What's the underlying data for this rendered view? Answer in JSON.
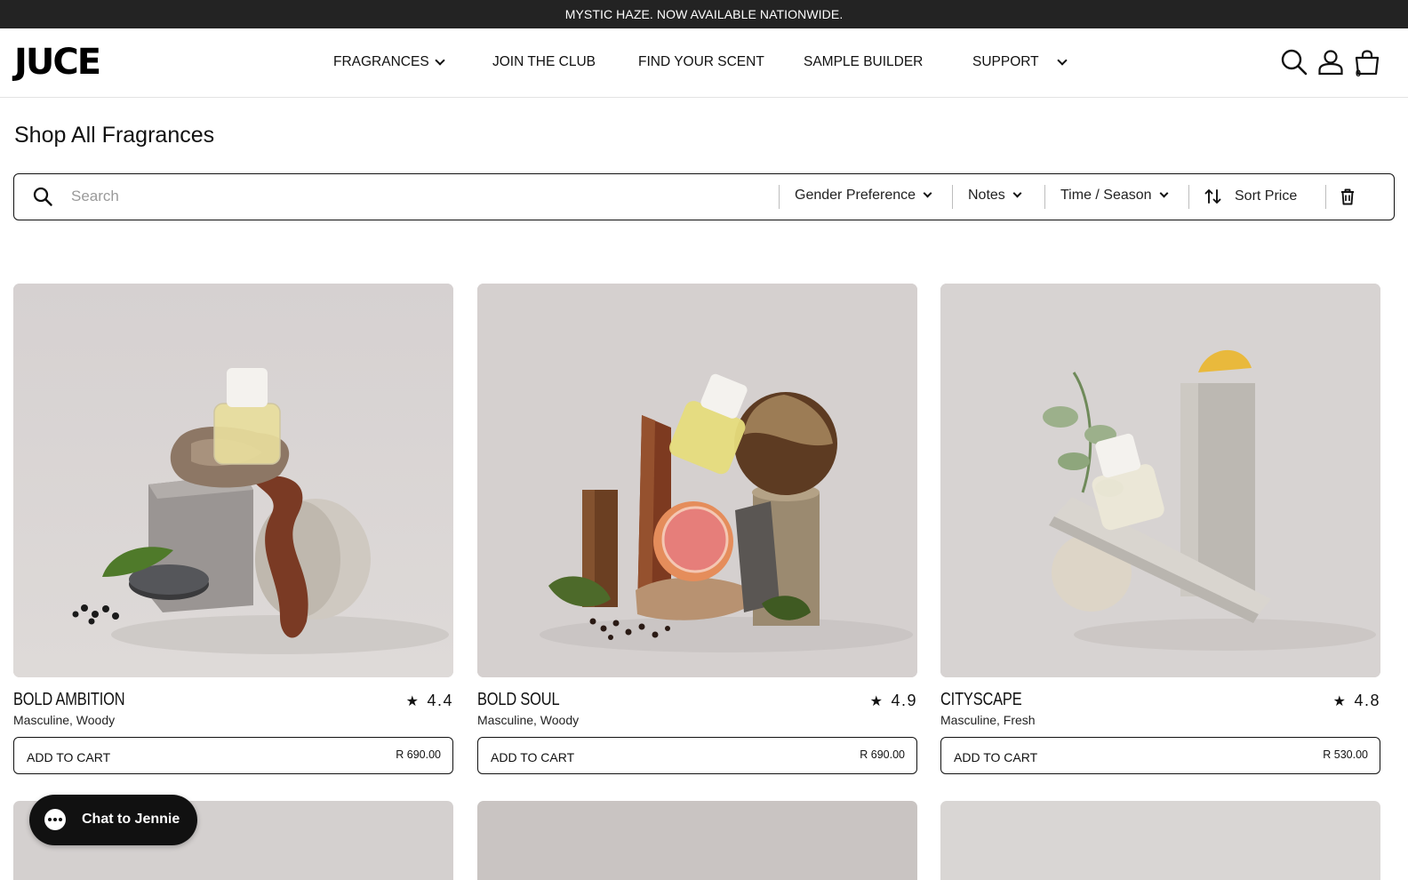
{
  "announcement": "MYSTIC HAZE. NOW AVAILABLE NATIONWIDE.",
  "brand": "JUCE",
  "nav": [
    {
      "label": "FRAGRANCES",
      "dropdown": true
    },
    {
      "label": "JOIN THE CLUB",
      "dropdown": false
    },
    {
      "label": "FIND YOUR SCENT",
      "dropdown": false
    },
    {
      "label": "SAMPLE BUILDER",
      "dropdown": false
    },
    {
      "label": "SUPPORT",
      "dropdown": true
    }
  ],
  "header_icons": [
    "search-icon",
    "account-icon",
    "cart-icon"
  ],
  "cart_count": "0",
  "page_title": "Shop All Fragrances",
  "search": {
    "placeholder": "Search",
    "value": ""
  },
  "filters": {
    "gender": "Gender Preference",
    "notes": "Notes",
    "season": "Time / Season",
    "sort": "Sort Price",
    "clear_icon": "trash-icon"
  },
  "products": [
    {
      "name": "BOLD AMBITION",
      "rating": "4.4",
      "tags": "Masculine, Woody",
      "cta": "ADD TO CART",
      "price": "R 690.00"
    },
    {
      "name": "BOLD SOUL",
      "rating": "4.9",
      "tags": "Masculine, Woody",
      "cta": "ADD TO CART",
      "price": "R 690.00"
    },
    {
      "name": "CITYSCAPE",
      "rating": "4.8",
      "tags": "Masculine, Fresh",
      "cta": "ADD TO CART",
      "price": "R 530.00"
    }
  ],
  "chat": {
    "label": "Chat to Jennie"
  },
  "colors": {
    "announce_bg": "#232323",
    "chat_bg": "#111111",
    "image_bg": "#d7d3d3"
  }
}
